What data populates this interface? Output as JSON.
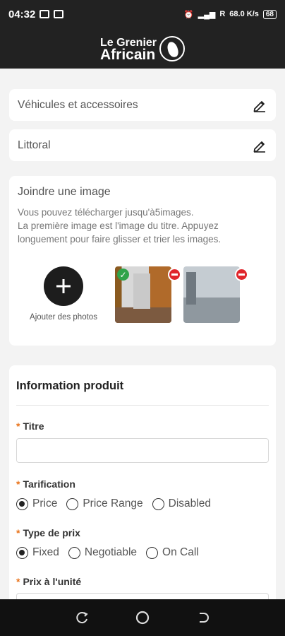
{
  "status_bar": {
    "time": "04:32",
    "network_speed": "68.0 K/s",
    "carrier": "R",
    "battery": "68"
  },
  "app": {
    "logo_line1": "Le Grenier",
    "logo_line2": "Africain"
  },
  "category_field": {
    "value": "Véhicules et accessoires",
    "icon": "pencil-icon"
  },
  "location_field": {
    "value": "Littoral",
    "icon": "pencil-icon"
  },
  "image_section": {
    "title": "Joindre une image",
    "desc_line1": "Vous pouvez télécharger jusqu'à5images.",
    "desc_line2": "La première image est l'image du titre. Appuyez",
    "desc_line3": "longuement pour faire glisser et trier les images.",
    "add_label": "Ajouter des photos",
    "photos": [
      {
        "primary": true
      },
      {
        "primary": false
      }
    ]
  },
  "product_info": {
    "title": "Information produit",
    "title_field": {
      "label": "Titre",
      "value": "",
      "required": true
    },
    "pricing": {
      "label": "Tarification",
      "options": [
        "Price",
        "Price Range",
        "Disabled"
      ],
      "selected": "Price"
    },
    "price_type": {
      "label": "Type de prix",
      "options": [
        "Fixed",
        "Negotiable",
        "On Call"
      ],
      "selected": "Fixed"
    },
    "unit_price": {
      "label": "Prix à l'unité",
      "required": true
    }
  },
  "colors": {
    "accent": "#e9741c",
    "header": "#222222",
    "remove": "#e0262c",
    "check": "#2fa34a"
  }
}
